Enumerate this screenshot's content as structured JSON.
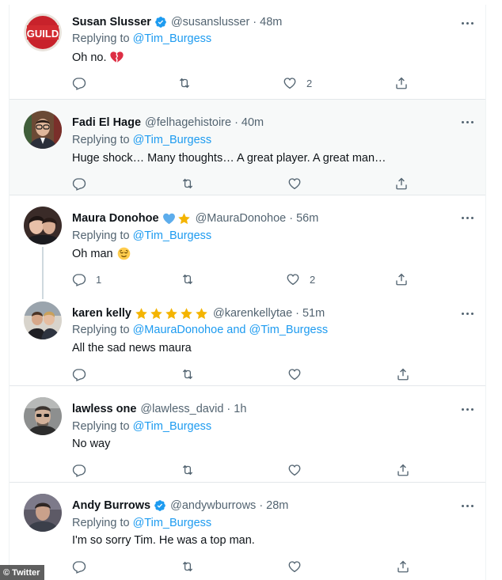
{
  "tweets": [
    {
      "name": "Susan Slusser",
      "verified": true,
      "handle": "@susanslusser",
      "separator": "·",
      "time": "48m",
      "reply_prefix": "Replying to ",
      "reply_to": "@Tim_Burgess",
      "text": "Oh no.",
      "text_emoji": "broken-heart",
      "avatar_text": "GUILD",
      "counts": {
        "reply": "",
        "retweet": "",
        "like": "2"
      }
    },
    {
      "name": "Fadi El Hage",
      "verified": false,
      "handle": "@felhagehistoire",
      "separator": "·",
      "time": "40m",
      "reply_prefix": "Replying to ",
      "reply_to": "@Tim_Burgess",
      "text": "Huge shock… Many thoughts… A great player. A great man…",
      "counts": {
        "reply": "",
        "retweet": "",
        "like": ""
      }
    },
    {
      "name": "Maura Donohoe",
      "name_emojis": [
        "blue-heart",
        "star"
      ],
      "handle": "@MauraDonohoe",
      "separator": "·",
      "time": "56m",
      "reply_prefix": "Replying to ",
      "reply_to": "@Tim_Burgess",
      "text": "Oh man",
      "text_emoji": "relieved-face",
      "counts": {
        "reply": "1",
        "retweet": "",
        "like": "2"
      }
    },
    {
      "name": "karen kelly",
      "name_emojis": [
        "star",
        "star",
        "star",
        "star",
        "star"
      ],
      "handle": "@karenkellytae",
      "separator": "·",
      "time": "51m",
      "reply_prefix": "Replying to ",
      "reply_to": "@MauraDonohoe and @Tim_Burgess",
      "text": "All the sad news maura",
      "counts": {
        "reply": "",
        "retweet": "",
        "like": ""
      }
    },
    {
      "name": "lawless one",
      "handle": "@lawless_david",
      "separator": "·",
      "time": "1h",
      "reply_prefix": "Replying to ",
      "reply_to": "@Tim_Burgess",
      "text": "No way",
      "counts": {
        "reply": "",
        "retweet": "",
        "like": ""
      }
    },
    {
      "name": "Andy Burrows",
      "verified": true,
      "handle": "@andywburrows",
      "separator": "·",
      "time": "28m",
      "reply_prefix": "Replying to ",
      "reply_to": "@Tim_Burgess",
      "text": "I'm so sorry Tim. He was a top man.",
      "counts": {
        "reply": "",
        "retweet": "",
        "like": ""
      }
    }
  ],
  "icons": {
    "reply": "reply-icon",
    "retweet": "retweet-icon",
    "like": "like-icon",
    "share": "share-icon",
    "more": "more-icon",
    "verified": "verified-badge-icon"
  },
  "colors": {
    "link": "#1d9bf0",
    "secondary_text": "#536471",
    "highlight_row": "#f7f9f9",
    "divider": "#e3e7ea",
    "thread_line": "#cfd9de",
    "star": "#f4b400",
    "blue_heart": "#5dadec"
  },
  "credit": "© Twitter"
}
